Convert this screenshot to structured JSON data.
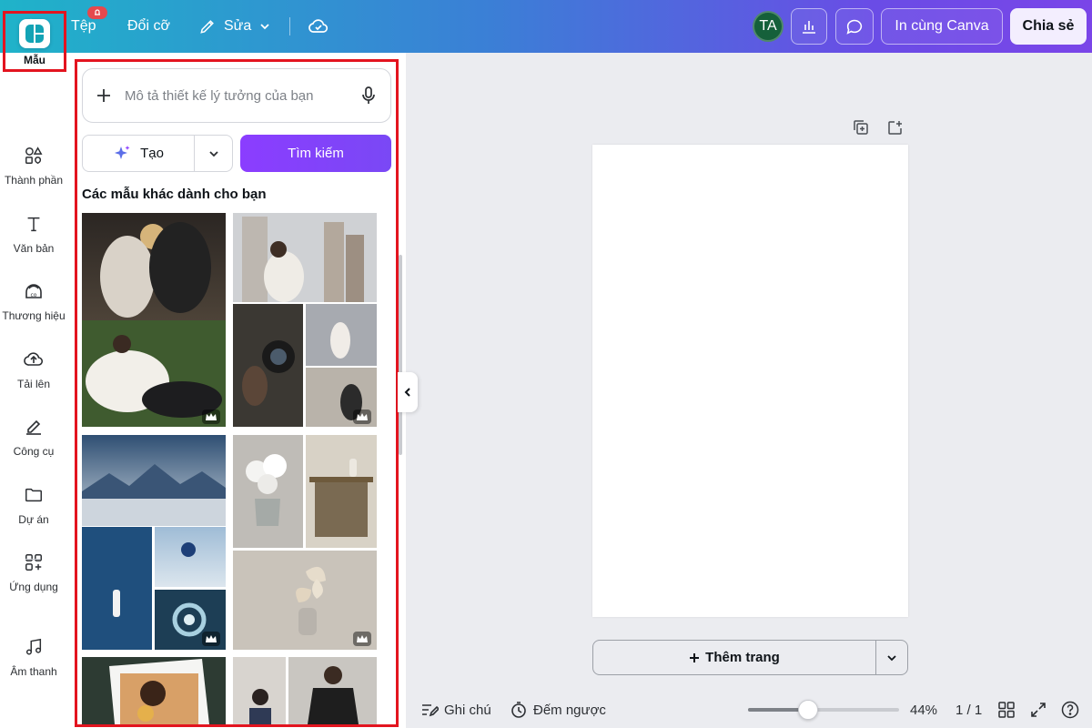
{
  "topbar": {
    "file_label": "Tệp",
    "resize_label": "Đổi cỡ",
    "edit_label": "Sửa",
    "avatar_initials": "TA",
    "print_label": "In cùng Canva",
    "share_label": "Chia sẻ"
  },
  "rail": {
    "items": [
      {
        "label": "Mẫu",
        "icon": "templates-icon",
        "active": true
      },
      {
        "label": "Thành phần",
        "icon": "elements-icon"
      },
      {
        "label": "Văn bản",
        "icon": "text-icon"
      },
      {
        "label": "Thương hiệu",
        "icon": "brand-icon"
      },
      {
        "label": "Tải lên",
        "icon": "upload-icon"
      },
      {
        "label": "Công cụ",
        "icon": "tools-icon"
      },
      {
        "label": "Dự án",
        "icon": "folder-icon"
      },
      {
        "label": "Ứng dụng",
        "icon": "apps-icon"
      },
      {
        "label": "Âm thanh",
        "icon": "music-icon"
      }
    ]
  },
  "panel": {
    "search_placeholder": "Mô tả thiết kế lý tưởng của bạn",
    "create_label": "Tạo",
    "find_label": "Tìm kiếm",
    "section_title": "Các mẫu khác dành cho bạn"
  },
  "canvas": {
    "add_page_label": "Thêm trang"
  },
  "bottombar": {
    "notes_label": "Ghi chú",
    "timer_label": "Đếm ngược",
    "zoom_percent": "44%",
    "zoom_value": 0.4,
    "page_count": "1 / 1"
  },
  "colors": {
    "accent_purple": "#8b3dff",
    "highlight_red": "#e3141f",
    "avatar_green": "#15603a"
  }
}
